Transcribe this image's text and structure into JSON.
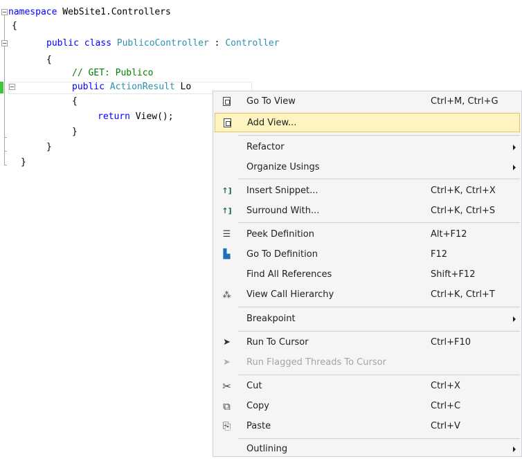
{
  "code": {
    "lines": [
      {
        "kw1": "namespace",
        "rest": " WebSite1.Controllers"
      },
      {
        "text": "{"
      },
      {
        "kw1": "public",
        "kw2": "class",
        "type": "PublicoController",
        "sep": " : ",
        "base": "Controller"
      },
      {
        "text": "{"
      },
      {
        "comment": "// GET: Publico"
      },
      {
        "kw1": "public",
        "type": "ActionResult",
        "rest": " Lo"
      },
      {
        "text": "{"
      },
      {
        "kw1": "return",
        "rest": " View();"
      },
      {
        "text": "}"
      },
      {
        "text": "}"
      },
      {
        "text": "}"
      }
    ]
  },
  "menu": {
    "items": [
      {
        "label": "Go To View",
        "shortcut": "Ctrl+M, Ctrl+G",
        "icon": "view-icon"
      },
      {
        "label": "Add View...",
        "shortcut": "",
        "icon": "add-view-icon",
        "highlighted": true
      },
      {
        "label": "Refactor",
        "shortcut": "",
        "submenu": true
      },
      {
        "label": "Organize Usings",
        "shortcut": "",
        "submenu": true
      },
      {
        "label": "Insert Snippet...",
        "shortcut": "Ctrl+K, Ctrl+X",
        "icon": "snippet-icon"
      },
      {
        "label": "Surround With...",
        "shortcut": "Ctrl+K, Ctrl+S",
        "icon": "surround-icon"
      },
      {
        "label": "Peek Definition",
        "shortcut": "Alt+F12",
        "icon": "peek-definition-icon"
      },
      {
        "label": "Go To Definition",
        "shortcut": "F12",
        "icon": "go-to-definition-icon"
      },
      {
        "label": "Find All References",
        "shortcut": "Shift+F12"
      },
      {
        "label": "View Call Hierarchy",
        "shortcut": "Ctrl+K, Ctrl+T",
        "icon": "call-hierarchy-icon"
      },
      {
        "label": "Breakpoint",
        "shortcut": "",
        "submenu": true
      },
      {
        "label": "Run To Cursor",
        "shortcut": "Ctrl+F10",
        "icon": "run-to-cursor-icon"
      },
      {
        "label": "Run Flagged Threads To Cursor",
        "shortcut": "",
        "icon": "run-flagged-icon",
        "disabled": true
      },
      {
        "label": "Cut",
        "shortcut": "Ctrl+X",
        "icon": "scissors-icon"
      },
      {
        "label": "Copy",
        "shortcut": "Ctrl+C",
        "icon": "copy-icon"
      },
      {
        "label": "Paste",
        "shortcut": "Ctrl+V",
        "icon": "paste-icon"
      },
      {
        "label": "Outlining",
        "shortcut": "",
        "submenu": true
      }
    ]
  },
  "colors": {
    "keyword": "#0000ff",
    "type": "#2b91af",
    "comment": "#008000",
    "highlight": "#fdf4bf",
    "change_bar": "#3fc63f"
  }
}
